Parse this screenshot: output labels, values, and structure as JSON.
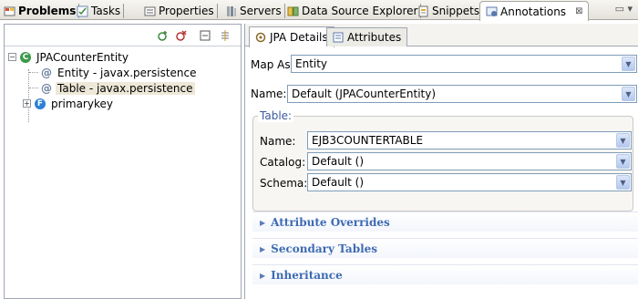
{
  "view_tabs": [
    {
      "label": "Problems",
      "icon": "problems-icon"
    },
    {
      "label": "Tasks",
      "icon": "tasks-icon"
    },
    {
      "label": "Properties",
      "icon": "properties-icon"
    },
    {
      "label": "Servers",
      "icon": "servers-icon"
    },
    {
      "label": "Data Source Explorer",
      "icon": "data-source-icon"
    },
    {
      "label": "Snippets",
      "icon": "snippets-icon"
    },
    {
      "label": "Annotations",
      "icon": "annotations-icon",
      "close": "⊠"
    }
  ],
  "view_menu": "▭ ▾",
  "tree": {
    "root": {
      "label": "JPACounterEntity",
      "expander": "−"
    },
    "children": [
      {
        "label": "Entity - javax.persistence"
      },
      {
        "label": "Table - javax.persistence"
      }
    ],
    "sibling": {
      "label": "primarykey",
      "expander": "+"
    }
  },
  "subtabs": [
    {
      "label": "JPA Details"
    },
    {
      "label": "Attributes"
    }
  ],
  "form": {
    "map_as_label": "Map As:",
    "map_as_value": "Entity",
    "name_label": "Name:",
    "name_value": "Default (JPACounterEntity)",
    "table_group": "Table:",
    "table_name_label": "Name:",
    "table_name_value": "EJB3COUNTERTABLE",
    "catalog_label": "Catalog:",
    "catalog_value": "Default ()",
    "schema_label": "Schema:",
    "schema_value": "Default ()"
  },
  "sections": [
    {
      "label": "Attribute Overrides"
    },
    {
      "label": "Secondary Tables"
    },
    {
      "label": "Inheritance"
    }
  ],
  "colors": {
    "accent": "#3e6bb3",
    "selection": "#eee8d8",
    "border": "#9fa6b4"
  }
}
